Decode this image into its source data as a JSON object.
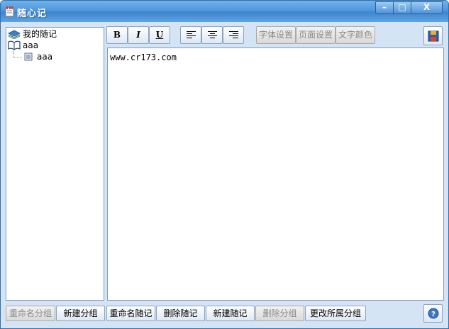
{
  "window": {
    "title": "随心记",
    "controls": {
      "minimize": "–",
      "maximize": "□",
      "close": "X"
    }
  },
  "tree": {
    "root": {
      "label": "我的随记",
      "icon": "books-icon"
    },
    "groups": [
      {
        "label": "aaa",
        "icon": "open-book-icon",
        "notes": [
          {
            "label": "aaa",
            "icon": "note-icon"
          }
        ]
      }
    ]
  },
  "toolbar": {
    "bold": "B",
    "italic": "I",
    "underline": "U",
    "align_left": "align-left-icon",
    "align_center": "align-center-icon",
    "align_right": "align-right-icon",
    "font_settings": "字体设置",
    "page_settings": "页面设置",
    "text_color": "文字颜色",
    "save": "save-icon"
  },
  "editor": {
    "content": "www.cr173.com"
  },
  "bottom_bar": {
    "rename_group": "重命名分组",
    "new_group": "新建分组",
    "rename_note": "重命名随记",
    "delete_note": "删除随记",
    "new_note": "新建随记",
    "delete_group": "删除分组",
    "change_group": "更改所属分组",
    "help": "help-icon"
  },
  "colors": {
    "titlebar": "#4f97dd",
    "window_bg": "#d4e4f4",
    "panel_border": "#7f9db9",
    "disabled_text": "#8a8a8a"
  }
}
